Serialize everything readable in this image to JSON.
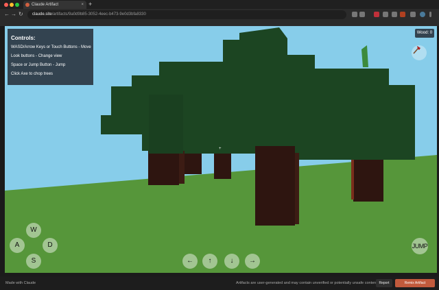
{
  "browser": {
    "tab_title": "Claude Artifact",
    "new_tab_glyph": "+",
    "close_glyph": "×",
    "back_glyph": "←",
    "forward_glyph": "→",
    "reload_glyph": "↻",
    "url_host": "claude.site",
    "url_path": "/artifacts/9a0d9b85-3052-4eec-b473-9e0d3bfa8330",
    "traffic_lights": [
      "#ff5f57",
      "#febc2e",
      "#28c840"
    ]
  },
  "game": {
    "controls_title": "Controls:",
    "controls": [
      "WASD/Arrow Keys or Touch Buttons - Move",
      "Look buttons - Change view",
      "Space or Jump Button - Jump",
      "Click Axe to chop trees"
    ],
    "wood_counter": "Wood: 0",
    "crosshair": "+",
    "move_buttons": {
      "w": "W",
      "a": "A",
      "s": "S",
      "d": "D"
    },
    "look_buttons": {
      "left": "←",
      "up": "↑",
      "down": "↓",
      "right": "→"
    },
    "jump_label": "JUMP",
    "axe_icon": "axe-icon",
    "colors": {
      "sky": "#87cdea",
      "grass": "#56963a",
      "leaves": "#1c4522",
      "trunk": "#2e1510"
    }
  },
  "footer": {
    "made_with": "Made with Claude",
    "disclaimer": "Artifacts are user-generated and may contain unverified or potentially unsafe content.",
    "report_label": "Report",
    "remix_label": "Remix Artifact"
  }
}
